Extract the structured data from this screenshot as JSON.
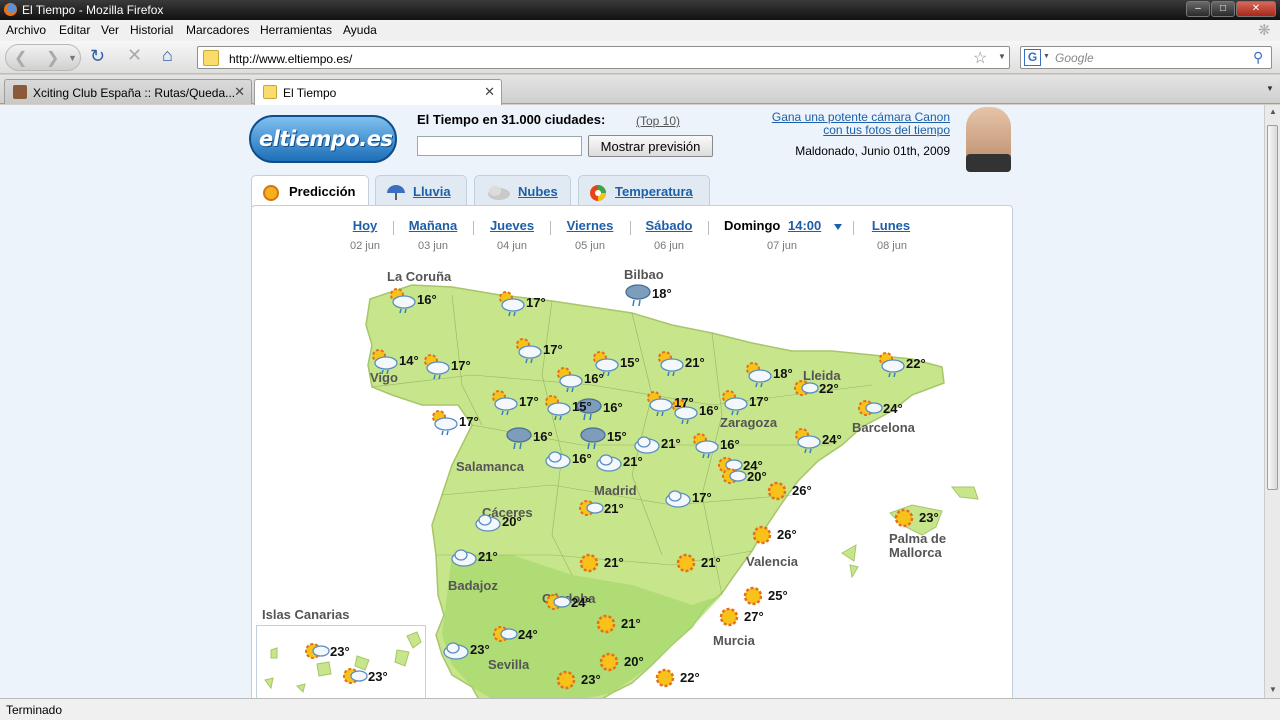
{
  "window": {
    "title": "El Tiempo - Mozilla Firefox"
  },
  "menu": [
    "Archivo",
    "Editar",
    "Ver",
    "Historial",
    "Marcadores",
    "Herramientas",
    "Ayuda"
  ],
  "navbar": {
    "url": "http://www.eltiempo.es/",
    "search_placeholder": "Google"
  },
  "tabs": [
    {
      "label": "Xciting Club España :: Rutas/Queda...",
      "active": false
    },
    {
      "label": "El Tiempo",
      "active": true
    }
  ],
  "header": {
    "logo": "eltiempo.es",
    "headline": "El Tiempo en 31.000 ciudades:",
    "top10": "(Top 10)",
    "button": "Mostrar previsión",
    "promo_line1": "Gana una potente cámara Canon",
    "promo_line2": "con tus fotos del tiempo",
    "date": "Maldonado, Junio 01th, 2009"
  },
  "page_tabs": [
    {
      "label": "Predicción",
      "icon": "sun-icon",
      "active": true
    },
    {
      "label": "Lluvia",
      "icon": "umbrella-icon",
      "active": false
    },
    {
      "label": "Nubes",
      "icon": "cloud-icon",
      "active": false
    },
    {
      "label": "Temperatura",
      "icon": "thermometer-icon",
      "active": false
    }
  ],
  "days": [
    {
      "name": "Hoy",
      "date": "02 jun"
    },
    {
      "name": "Mañana",
      "date": "03 jun"
    },
    {
      "name": "Jueves",
      "date": "04 jun"
    },
    {
      "name": "Viernes",
      "date": "05 jun"
    },
    {
      "name": "Sábado",
      "date": "06 jun"
    },
    {
      "name": "Domingo",
      "date": "07 jun",
      "time": "14:00"
    },
    {
      "name": "Lunes",
      "date": "08 jun"
    }
  ],
  "cities": [
    "La Coruña",
    "Bilbao",
    "Vigo",
    "Lleida",
    "Zaragoza",
    "Barcelona",
    "Salamanca",
    "Madrid",
    "Cáceres",
    "Palma de",
    "Mallorca",
    "Valencia",
    "Badajoz",
    "Córdoba",
    "Murcia",
    "Sevilla",
    "Islas Canarias"
  ],
  "weather": [
    {
      "temp": "16°",
      "icon": "sun-rain-icon"
    },
    {
      "temp": "17°",
      "icon": "sun-rain-icon"
    },
    {
      "temp": "16°",
      "icon": "rain-icon"
    },
    {
      "temp": "18°",
      "icon": "rain-icon"
    },
    {
      "temp": "16°",
      "icon": "sun-rain-icon"
    },
    {
      "temp": "17°",
      "icon": "sun-rain-icon"
    },
    {
      "temp": "14°",
      "icon": "sun-rain-icon"
    },
    {
      "temp": "17°",
      "icon": "sun-rain-icon"
    },
    {
      "temp": "17°",
      "icon": "sun-rain-icon"
    },
    {
      "temp": "15°",
      "icon": "sun-rain-icon"
    },
    {
      "temp": "17°",
      "icon": "sun-rain-icon"
    },
    {
      "temp": "16°",
      "icon": "sun-rain-icon"
    },
    {
      "temp": "16°",
      "icon": "sun-rain-icon"
    },
    {
      "temp": "21°",
      "icon": "sun-rain-icon"
    },
    {
      "temp": "18°",
      "icon": "sun-rain-icon"
    },
    {
      "temp": "22°",
      "icon": "sun-rain-icon"
    },
    {
      "temp": "17°",
      "icon": "sun-rain-icon"
    },
    {
      "temp": "15°",
      "icon": "sun-rain-icon"
    },
    {
      "temp": "17°",
      "icon": "sun-rain-icon"
    },
    {
      "temp": "22°",
      "icon": "sun-cloud-icon"
    },
    {
      "temp": "24°",
      "icon": "sun-cloud-icon"
    },
    {
      "temp": "24°",
      "icon": "sun-rain-icon"
    },
    {
      "temp": "16°",
      "icon": "rain-icon"
    },
    {
      "temp": "15°",
      "icon": "rain-icon"
    },
    {
      "temp": "21°",
      "icon": "cloud-icon"
    },
    {
      "temp": "16°",
      "icon": "cloud-icon"
    },
    {
      "temp": "21°",
      "icon": "cloud-icon"
    },
    {
      "temp": "24°",
      "icon": "sun-cloud-icon"
    },
    {
      "temp": "20°",
      "icon": "sun-cloud-icon"
    },
    {
      "temp": "17°",
      "icon": "cloud-icon"
    },
    {
      "temp": "26°",
      "icon": "sun-icon"
    },
    {
      "temp": "21°",
      "icon": "sun-cloud-icon"
    },
    {
      "temp": "20°",
      "icon": "cloud-icon"
    },
    {
      "temp": "23°",
      "icon": "sun-icon"
    },
    {
      "temp": "26°",
      "icon": "sun-icon"
    },
    {
      "temp": "21°",
      "icon": "cloud-icon"
    },
    {
      "temp": "21°",
      "icon": "sun-icon"
    },
    {
      "temp": "21°",
      "icon": "sun-icon"
    },
    {
      "temp": "25°",
      "icon": "sun-icon"
    },
    {
      "temp": "24°",
      "icon": "sun-cloud-icon"
    },
    {
      "temp": "21°",
      "icon": "sun-icon"
    },
    {
      "temp": "27°",
      "icon": "sun-icon"
    },
    {
      "temp": "23°",
      "icon": "cloud-icon"
    },
    {
      "temp": "24°",
      "icon": "sun-cloud-icon"
    },
    {
      "temp": "20°",
      "icon": "sun-icon"
    },
    {
      "temp": "23°",
      "icon": "sun-icon"
    },
    {
      "temp": "22°",
      "icon": "sun-icon"
    },
    {
      "temp": "23°",
      "icon": "sun-cloud-icon"
    },
    {
      "temp": "23°",
      "icon": "sun-cloud-icon"
    }
  ],
  "status": "Terminado"
}
